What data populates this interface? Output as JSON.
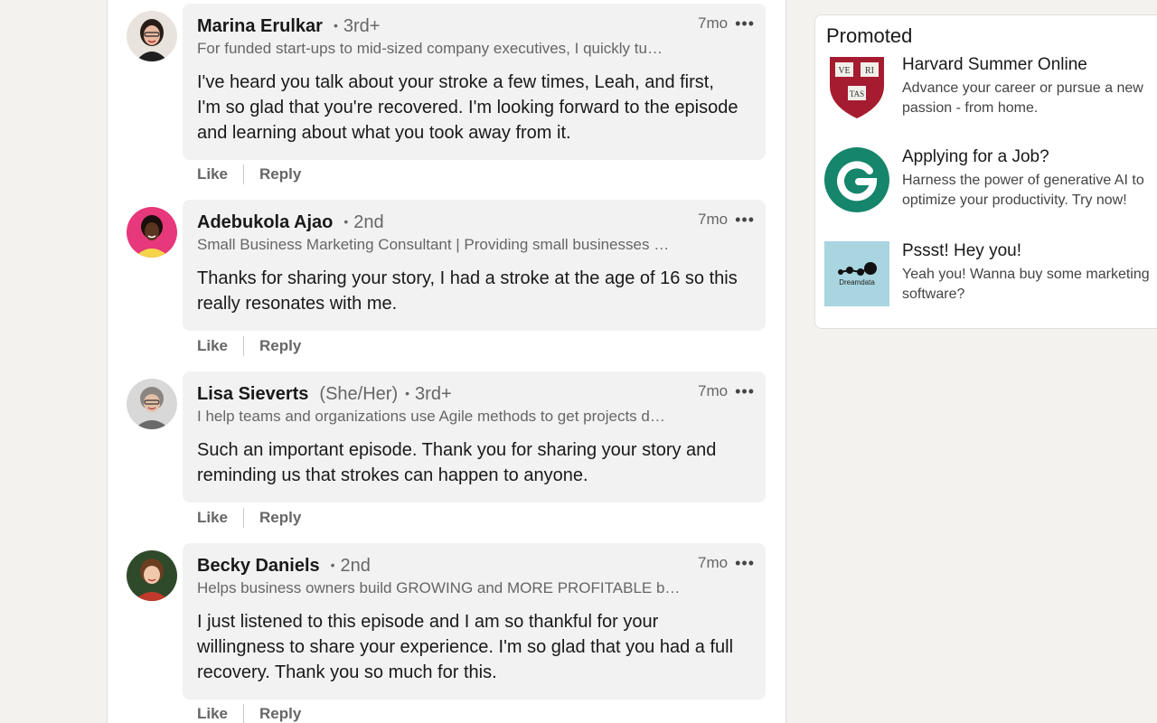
{
  "comments": [
    {
      "name": "Marina Erulkar",
      "pronouns": "",
      "degree": "3rd+",
      "time": "7mo",
      "headline": "For funded start-ups to mid-sized company executives, I quickly tu…",
      "text": "I've heard you talk about your stroke a few times, Leah, and first, I'm so glad that you're recovered. I'm looking forward to the episode and learning about what you took away from it.",
      "like": "Like",
      "reply": "Reply"
    },
    {
      "name": "Adebukola Ajao",
      "pronouns": "",
      "degree": "2nd",
      "time": "7mo",
      "headline": "Small Business Marketing Consultant | Providing small businesses …",
      "text": "Thanks for sharing your story, I had a stroke at the age of 16 so this really resonates with me.",
      "like": "Like",
      "reply": "Reply"
    },
    {
      "name": "Lisa Sieverts",
      "pronouns": "(She/Her)",
      "degree": "3rd+",
      "time": "7mo",
      "headline": "I help teams and organizations use Agile methods to get projects d…",
      "text": "Such an important episode. Thank you for sharing your story and reminding us that strokes can happen to anyone.",
      "like": "Like",
      "reply": "Reply"
    },
    {
      "name": "Becky Daniels",
      "pronouns": "",
      "degree": "2nd",
      "time": "7mo",
      "headline": "Helps business owners build GROWING and MORE PROFITABLE bu…",
      "text": "I just listened to this episode and I am so thankful for your willingness to share your experience. I'm so glad that you had a full recovery. Thank you so much for this.",
      "like": "Like",
      "reply": "Reply"
    }
  ],
  "promoted": {
    "title": "Promoted",
    "ads": [
      {
        "title": "Harvard Summer Online",
        "desc": "Advance your career or pursue a new passion - from home.",
        "logo": "harvard-shield-icon",
        "logo_text": [
          "VE",
          "RI",
          "TAS"
        ]
      },
      {
        "title": "Applying for a Job?",
        "desc": "Harness the power of generative AI to optimize your productivity. Try now!",
        "logo": "grammarly-g-icon"
      },
      {
        "title": "Pssst! Hey you!",
        "desc": "Yeah you! Wanna buy some marketing software?",
        "logo": "dreamdata-logo-icon",
        "logo_text": "Dreamdata"
      }
    ]
  },
  "colors": {
    "page_bg": "#f4f2ee",
    "bubble_bg": "#f2f2f2",
    "harvard_red": "#a51c30",
    "grammarly_green": "#15856b",
    "dreamdata_bg": "#a8d5e0"
  }
}
